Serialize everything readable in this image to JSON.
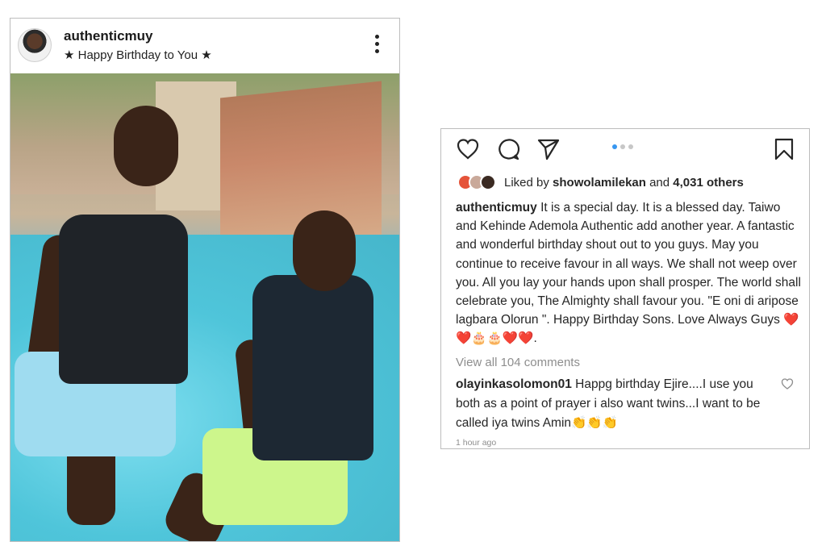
{
  "post": {
    "username": "authenticmuy",
    "location": "★ Happy Birthday to You ★"
  },
  "panel": {
    "liked_prefix": "Liked by",
    "liked_user": "showolamilekan",
    "liked_and": "and",
    "liked_others": "4,031 others",
    "caption_user": "authenticmuy",
    "caption_text": "It is a special day. It is a blessed day. Taiwo and Kehinde Ademola Authentic add another year. A fantastic and wonderful birthday shout out to you guys. May you continue to receive favour in all ways. We shall not weep over you. All you lay your hands upon shall prosper.  The world shall celebrate you, The Almighty shall favour you. \"E oni di aripose lagbara Olorun \". Happy Birthday Sons. Love Always Guys ❤️❤️🎂🎂❤️❤️.",
    "view_all": "View all 104 comments",
    "comment_user": "olayinkasolomon01",
    "comment_text": "Happg birthday Ejire....I use you both as a point of prayer i also want twins...I want to be called iya twins Amin👏👏👏",
    "time": "1 hour ago"
  },
  "icons": {
    "like": "heart-icon",
    "comment": "comment-icon",
    "share": "send-icon",
    "save": "bookmark-icon",
    "more": "more-vertical-icon"
  },
  "colors": {
    "accent": "#3897f0",
    "muted": "#8e8e8e",
    "text": "#262626",
    "border": "#bdbdbd"
  }
}
